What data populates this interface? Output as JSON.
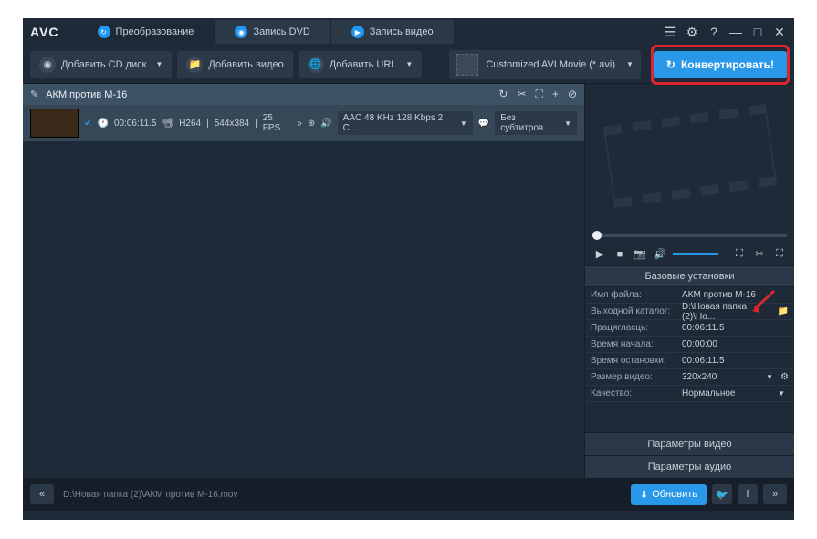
{
  "logo": "AVC",
  "tabs": [
    {
      "label": "Преобразование",
      "icon": "↻"
    },
    {
      "label": "Запись DVD",
      "icon": "◉"
    },
    {
      "label": "Запись видео",
      "icon": "▶"
    }
  ],
  "toolbar": {
    "add_cd": "Добавить CD диск",
    "add_video": "Добавить видео",
    "add_url": "Добавить URL",
    "format": "Customized AVI Movie (*.avi)",
    "convert": "Конвертировать!"
  },
  "item": {
    "title": "АКМ против М-16",
    "duration": "00:06:11.5",
    "codec": "H264",
    "resolution": "544x384",
    "fps": "25 FPS",
    "audio": "AAC 48 KHz 128 Kbps 2 C...",
    "subtitle": "Без субтитров"
  },
  "settings": {
    "header": "Базовые установки",
    "rows": {
      "filename": {
        "label": "Имя файла:",
        "value": "АКМ против М-16"
      },
      "outdir": {
        "label": "Выходной каталог:",
        "value": "D:\\Новая папка (2)\\Но..."
      },
      "length": {
        "label": "Працягласць:",
        "value": "00:06:11.5"
      },
      "start": {
        "label": "Время начала:",
        "value": "00:00:00"
      },
      "stop": {
        "label": "Время остановки:",
        "value": "00:06:11.5"
      },
      "size": {
        "label": "Размер видео:",
        "value": "320x240"
      },
      "quality": {
        "label": "Качество:",
        "value": "Нормальное"
      }
    },
    "video_params": "Параметры видео",
    "audio_params": "Параметры аудио"
  },
  "statusbar": {
    "path": "D:\\Новая папка (2)\\АКМ против М-16.mov",
    "update": "Обновить"
  }
}
